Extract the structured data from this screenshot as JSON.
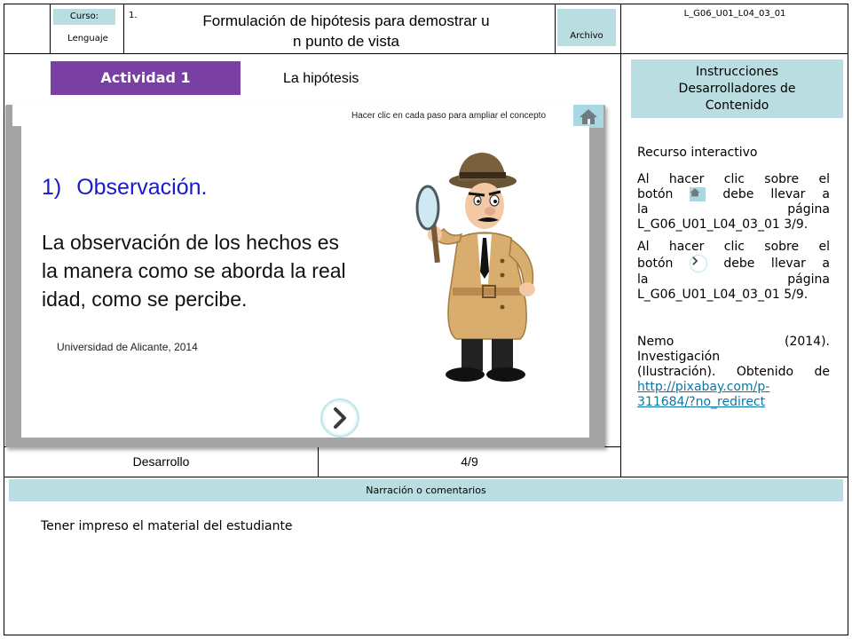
{
  "header": {
    "curso_label": "Curso:",
    "curso_value": "Lenguaje",
    "number": "1.",
    "title_line1": "Formulación de hipótesis para demostrar u",
    "title_line2": "n punto de vista",
    "archivo_label": "Archivo",
    "file_code": "L_G06_U01_L04_03_01"
  },
  "activity": {
    "badge": "Actividad 1",
    "subtitle": "La hipótesis"
  },
  "slide": {
    "hint": "Hacer clic en cada paso para ampliar el concepto",
    "step_number": "1)",
    "step_title": "Observación.",
    "body_line1": "La observación de los hechos es",
    "body_line2": "la manera como se aborda la real",
    "body_line3": "idad, como se percibe.",
    "citation": "Universidad de Alicante, 2014",
    "colors": {
      "step_title": "#1a1ac8",
      "badge": "#7a3fa3"
    }
  },
  "footer_row": {
    "section": "Desarrollo",
    "page": "4/9"
  },
  "sidebar": {
    "header": "Instrucciones Desarrolladores de Contenido",
    "resource": "Recurso interactivo",
    "instr1_a": "Al hacer clic sobre el",
    "instr1_b_pre": "botón",
    "instr1_b_post": "debe llevar a",
    "instr1_c_pre": "la",
    "instr1_c_post": "página",
    "instr1_d": "L_G06_U01_L04_03_01 3/9.",
    "instr2_a": "Al hacer clic sobre el",
    "instr2_b_pre": "botón",
    "instr2_b_post": "debe llevar a",
    "instr2_c_pre": "la",
    "instr2_c_post": "página",
    "instr2_d": "L_G06_U01_L04_03_01 5/9.",
    "credit_a_left": "Nemo",
    "credit_a_right": "(2014).",
    "credit_b": "Investigación",
    "credit_c_left": "(Ilustración).",
    "credit_c_right": "Obtenido de",
    "link1": "http://pixabay.com/p-",
    "link2": "311684/?no_redirect"
  },
  "narration": {
    "header": "Narración o comentarios",
    "text": "Tener impreso el material del estudiante"
  }
}
